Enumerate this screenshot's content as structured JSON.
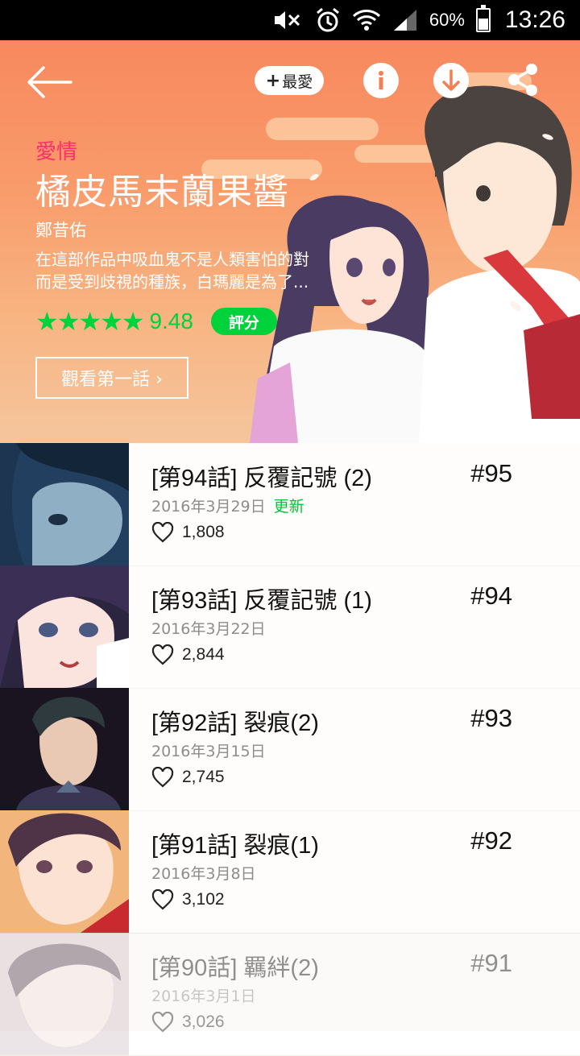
{
  "status_bar": {
    "battery_pct": "60%",
    "battery_level": 0.6,
    "time": "13:26",
    "icons": [
      "mute-icon",
      "alarm-icon",
      "wifi-icon",
      "signal-icon",
      "battery-icon"
    ]
  },
  "header": {
    "back_icon": "arrow-left-icon",
    "fav_label": "最愛",
    "info_icon": "info-icon",
    "download_icon": "download-icon",
    "share_icon": "share-icon"
  },
  "series": {
    "genre": "愛情",
    "title": "橘皮馬末蘭果醬",
    "author": "鄭昔佑",
    "synopsis_line1": "在這部作品中吸血鬼不是人類害怕的對",
    "synopsis_line2": "而是受到歧視的種族，白瑪麗是為了...",
    "stars": "★★★★★",
    "rating_value": 9.48,
    "score": "9.48",
    "rate_label": "評分",
    "first_episode_label": "觀看第一話 ›"
  },
  "colors": {
    "accent_green": "#00d23c",
    "genre_pink": "#ff2d6e",
    "hero_orange": "#f7895e"
  },
  "episodes": [
    {
      "title": "[第94話] 反覆記號 (2)",
      "number": "#95",
      "date": "2016年3月29日",
      "badge": "更新",
      "likes": "1,808"
    },
    {
      "title": "[第93話] 反覆記號 (1)",
      "number": "#94",
      "date": "2016年3月22日",
      "badge": "",
      "likes": "2,844"
    },
    {
      "title": "[第92話] 裂痕(2)",
      "number": "#93",
      "date": "2016年3月15日",
      "badge": "",
      "likes": "2,745"
    },
    {
      "title": "[第91話] 裂痕(1)",
      "number": "#92",
      "date": "2016年3月8日",
      "badge": "",
      "likes": "3,102"
    },
    {
      "title": "[第90話] 羈絆(2)",
      "number": "#91",
      "date": "2016年3月1日",
      "badge": "",
      "likes": "3,026"
    }
  ]
}
